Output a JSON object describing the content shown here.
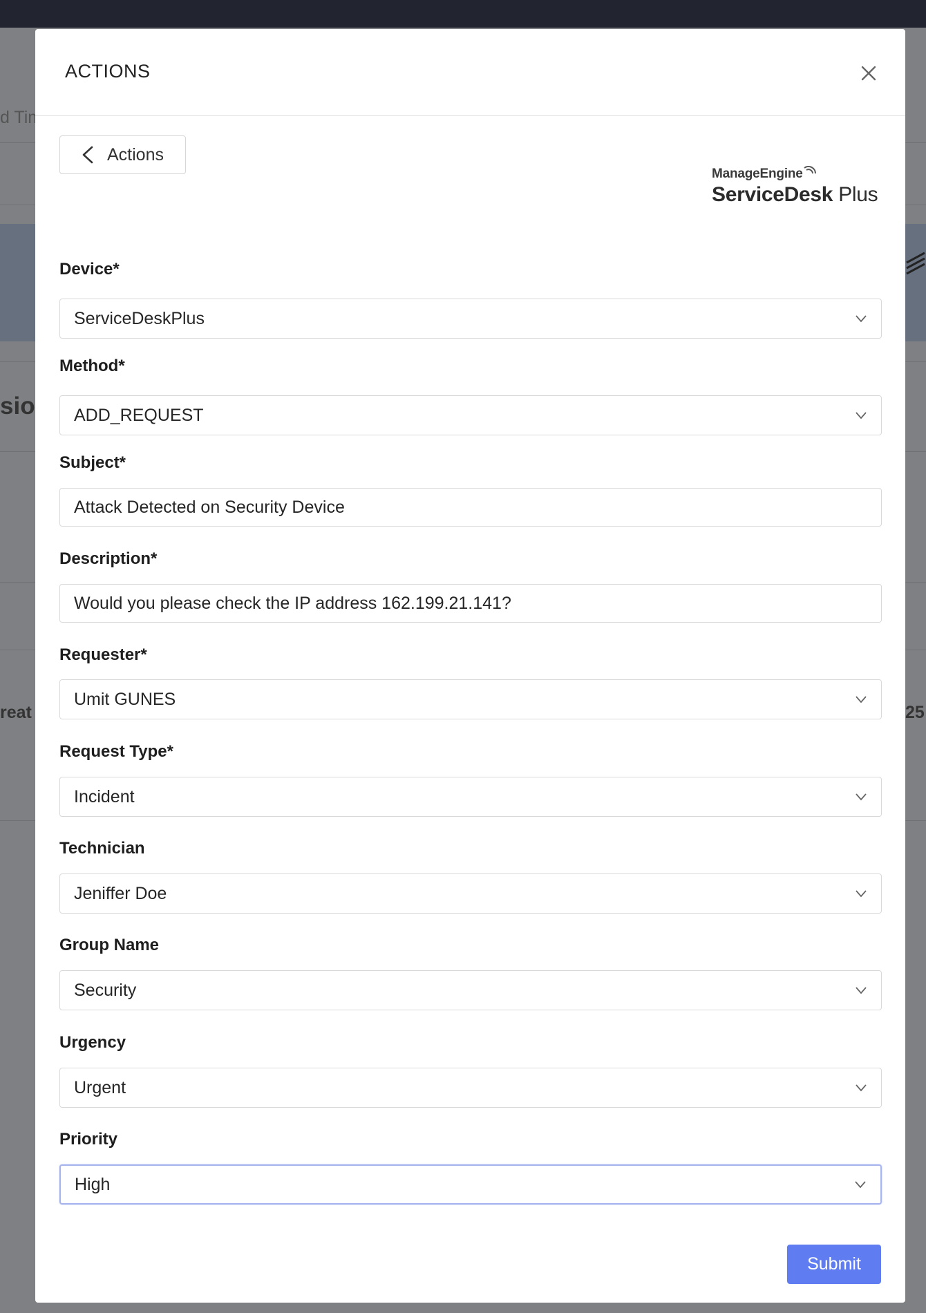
{
  "background": {
    "fragments": [
      "d Tim",
      "sior",
      "reat",
      "25"
    ]
  },
  "modal": {
    "title": "ACTIONS",
    "back_label": "Actions",
    "logo": {
      "top": "ManageEngine",
      "main_bold": "ServiceDesk",
      "main_light": " Plus"
    },
    "fields": [
      {
        "label": "Device*",
        "value": "ServiceDeskPlus",
        "kind": "select"
      },
      {
        "label": "Method*",
        "value": "ADD_REQUEST",
        "kind": "select"
      },
      {
        "label": "Subject*",
        "value": "Attack Detected on Security Device",
        "kind": "text"
      },
      {
        "label": "Description*",
        "value": "Would you please check the IP address 162.199.21.141?",
        "kind": "text"
      },
      {
        "label": "Requester*",
        "value": "Umit GUNES",
        "kind": "select"
      },
      {
        "label": "Request Type*",
        "value": "Incident",
        "kind": "select"
      },
      {
        "label": "Technician",
        "value": "Jeniffer Doe",
        "kind": "select"
      },
      {
        "label": "Group Name",
        "value": "Security",
        "kind": "select"
      },
      {
        "label": "Urgency",
        "value": "Urgent",
        "kind": "select"
      },
      {
        "label": "Priority",
        "value": "High",
        "kind": "select",
        "focused": true
      }
    ],
    "submit_label": "Submit"
  },
  "colors": {
    "accent": "#5f7df0",
    "overlay": "#7f8083",
    "topbar": "#22252f"
  }
}
